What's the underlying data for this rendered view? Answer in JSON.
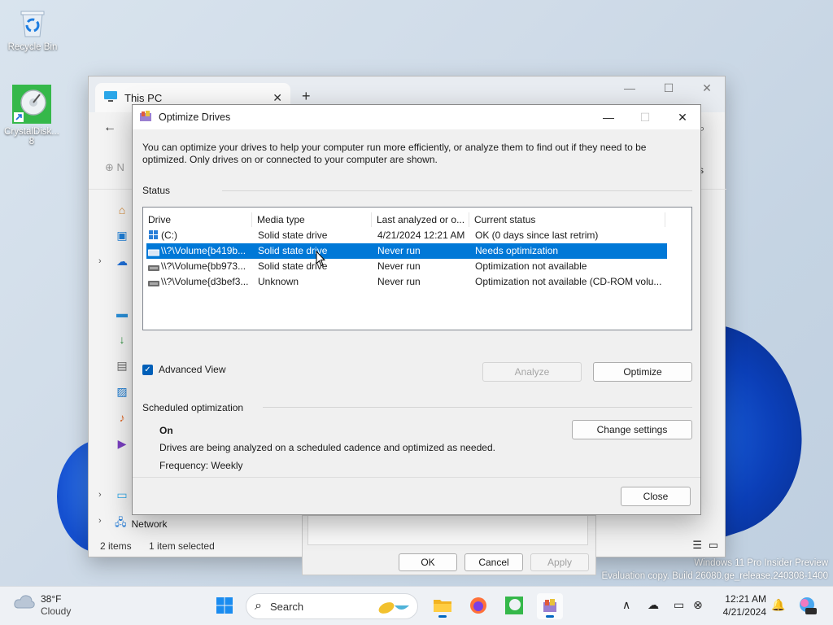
{
  "desktop": {
    "icons": [
      {
        "label": "Recycle Bin"
      },
      {
        "label": "CrystalDisk... 8"
      }
    ],
    "watermark": {
      "line1": "Windows 11 Pro Insider Preview",
      "line2": "Evaluation copy. Build 26080.ge_release.240308-1400"
    }
  },
  "explorer": {
    "tab_title": "This PC",
    "status_items": "2 items",
    "status_selected": "1 item selected",
    "sidebar_network": "Network",
    "toolbar_partial_new": "N",
    "toolbar_partial_right": "s"
  },
  "properties": {
    "ok": "OK",
    "cancel": "Cancel",
    "apply": "Apply"
  },
  "dialog": {
    "title": "Optimize Drives",
    "description": "You can optimize your drives to help your computer run more efficiently, or analyze them to find out if they need to be optimized. Only drives on or connected to your computer are shown.",
    "status_label": "Status",
    "columns": [
      "Drive",
      "Media type",
      "Last analyzed or o...",
      "Current status"
    ],
    "drives": [
      {
        "drive": "(C:)",
        "media": "Solid state drive",
        "last": "4/21/2024 12:21 AM",
        "status": "OK (0 days since last retrim)",
        "selected": false
      },
      {
        "drive": "\\\\?\\Volume{b419b...",
        "media": "Solid state drive",
        "last": "Never run",
        "status": "Needs optimization",
        "selected": true
      },
      {
        "drive": "\\\\?\\Volume{bb973...",
        "media": "Solid state drive",
        "last": "Never run",
        "status": "Optimization not available",
        "selected": false
      },
      {
        "drive": "\\\\?\\Volume{d3bef3...",
        "media": "Unknown",
        "last": "Never run",
        "status": "Optimization not available (CD-ROM volu...",
        "selected": false
      }
    ],
    "advanced_view_label": "Advanced View",
    "advanced_view_checked": true,
    "analyze_label": "Analyze",
    "optimize_label": "Optimize",
    "scheduled_label": "Scheduled optimization",
    "sched_state": "On",
    "sched_desc": "Drives are being analyzed on a scheduled cadence and optimized as needed.",
    "sched_frequency": "Frequency: Weekly",
    "change_settings_label": "Change settings",
    "close_label": "Close"
  },
  "taskbar": {
    "weather_temp": "38°F",
    "weather_cond": "Cloudy",
    "search_label": "Search",
    "time": "12:21 AM",
    "date": "4/21/2024",
    "accent": "#0067c0"
  },
  "colors": {
    "selection": "#0078d7",
    "checkbox": "#005fb8"
  }
}
